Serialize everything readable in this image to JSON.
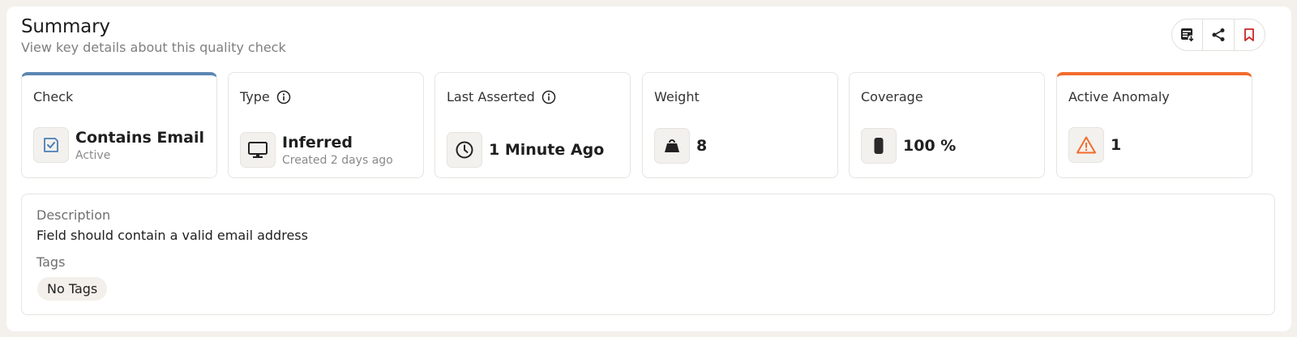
{
  "header": {
    "title": "Summary",
    "subtitle": "View key details about this quality check"
  },
  "actions": {
    "items": [
      {
        "icon": "export-icon"
      },
      {
        "icon": "share-icon"
      },
      {
        "icon": "bookmark-icon"
      }
    ],
    "bookmark_color": "#c62828"
  },
  "cards": {
    "check": {
      "label": "Check",
      "value": "Contains Email",
      "sub": "Active",
      "icon": "check-square-icon",
      "accent": "#5b86b3"
    },
    "type": {
      "label": "Type",
      "value": "Inferred",
      "sub": "Created 2 days ago",
      "icon": "monitor-icon"
    },
    "last_asserted": {
      "label": "Last Asserted",
      "value": "1 Minute Ago",
      "icon": "clock-icon"
    },
    "weight": {
      "label": "Weight",
      "value": "8",
      "icon": "weight-icon"
    },
    "coverage": {
      "label": "Coverage",
      "value": "100 %",
      "icon": "coverage-icon"
    },
    "active_anomaly": {
      "label": "Active Anomaly",
      "value": "1",
      "icon": "warning-icon",
      "accent": "#f26c2c"
    }
  },
  "details": {
    "description_label": "Description",
    "description": "Field should contain a valid email address",
    "tags_label": "Tags",
    "tags_empty": "No Tags"
  }
}
